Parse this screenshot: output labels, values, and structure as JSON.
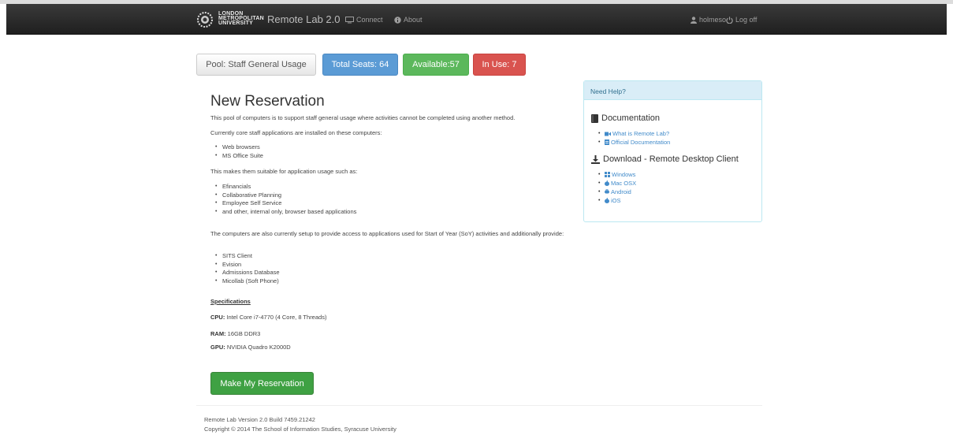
{
  "navbar": {
    "logo_lines": [
      "LONDON",
      "METROPOLITAN",
      "UNIVERSITY"
    ],
    "brand": "Remote Lab 2.0",
    "connect": "Connect",
    "about": "About",
    "user": "holmeso",
    "logoff": "Log off"
  },
  "pool": {
    "name": "Pool: Staff General Usage",
    "total": "Total Seats: 64",
    "available": "Available:57",
    "in_use": "In Use: 7"
  },
  "reservation": {
    "title": "New Reservation",
    "intro": "This pool of computers is to support staff general usage where activities cannot be completed using another method.",
    "core_intro": "Currently core staff applications are installed on these computers:",
    "core_apps": [
      "Web browsers",
      "MS Office Suite"
    ],
    "usage_intro": "This makes them suitable for application usage such as:",
    "usage": [
      "Efinancials",
      "Collaborative Planning",
      "Employee Self Service",
      "and other, internal only, browser based applications"
    ],
    "soy_intro": "The computers are also currently setup to provide access to applications used for Start of Year (SoY) activities and additionally provide:",
    "soy_apps": [
      "SITS Client",
      "Evision",
      "Admissions Database",
      "Micollab (Soft Phone)"
    ],
    "spec_heading": "Specifications",
    "cpu_label": "CPU:",
    "cpu": "Intel Core i7-4770 (4 Core, 8 Threads)",
    "ram_label": "RAM:",
    "ram": "16GB DDR3",
    "gpu_label": "GPU:",
    "gpu": "NVIDIA Quadro K2000D",
    "button": "Make My Reservation"
  },
  "help": {
    "heading": "Need Help?",
    "docs_title": "Documentation",
    "docs": [
      "What is Remote Lab?",
      "Official Documentation"
    ],
    "download_title": "Download - Remote Desktop Client",
    "downloads": [
      "Windows",
      "Mac OSX",
      "Android",
      "iOS"
    ]
  },
  "footer": {
    "version": "Remote Lab Version 2.0 Build 7459.21242",
    "copyright": "Copyright © 2014 The School of Information Studies, Syracuse University"
  },
  "colors": {
    "navbar": "#1f1f1f",
    "total": "#5b9bd5",
    "available": "#5cb85c",
    "in_use": "#d9534f",
    "reserve": "#3fa143",
    "help_head": "#d9edf7",
    "link": "#428bca"
  }
}
